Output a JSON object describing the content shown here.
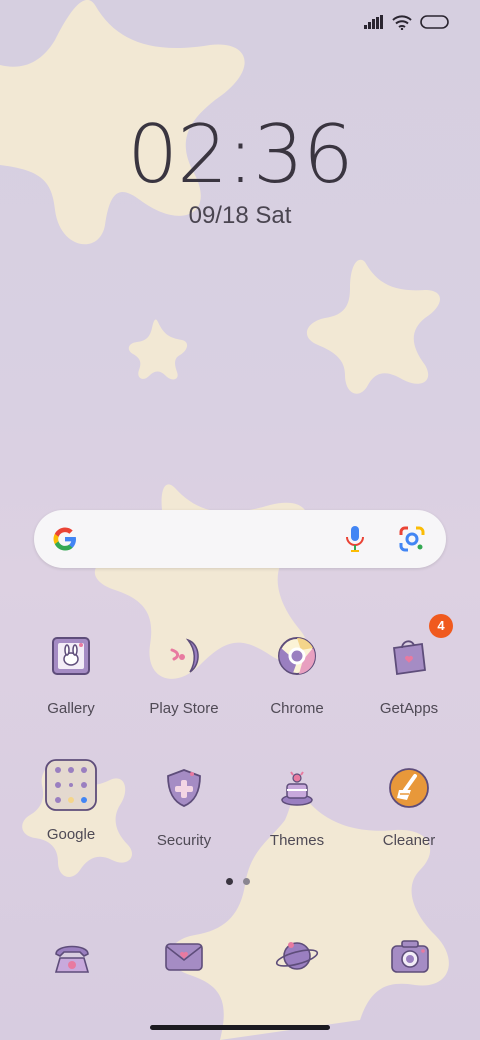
{
  "status_bar": {
    "icons": [
      "signal-icon",
      "wifi-icon",
      "battery-icon"
    ]
  },
  "clock": {
    "time": "02:36"
  },
  "date": {
    "day": "09/18",
    "weekday": "Sat"
  },
  "search_bar": {
    "logo": "google-g-icon",
    "icons": [
      "mic-icon",
      "lens-icon"
    ]
  },
  "apps": [
    {
      "label": "Gallery",
      "icon": "gallery-icon"
    },
    {
      "label": "Play Store",
      "icon": "play-store-icon"
    },
    {
      "label": "Chrome",
      "icon": "chrome-icon"
    },
    {
      "label": "GetApps",
      "icon": "getapps-icon",
      "badge": "4"
    },
    {
      "label": "Google",
      "icon": "google-folder-icon"
    },
    {
      "label": "Security",
      "icon": "security-icon"
    },
    {
      "label": "Themes",
      "icon": "themes-icon"
    },
    {
      "label": "Cleaner",
      "icon": "cleaner-icon"
    }
  ],
  "page_indicator": {
    "pages": 2,
    "current": 1
  },
  "dock": [
    {
      "icon": "phone-icon"
    },
    {
      "icon": "messages-icon"
    },
    {
      "icon": "browser-planet-icon"
    },
    {
      "icon": "camera-icon"
    }
  ],
  "colors": {
    "wallpaper": "#d8cfe1",
    "star": "#f4ead3",
    "icon_purple": "#9a86b8",
    "badge": "#f05a1e"
  }
}
